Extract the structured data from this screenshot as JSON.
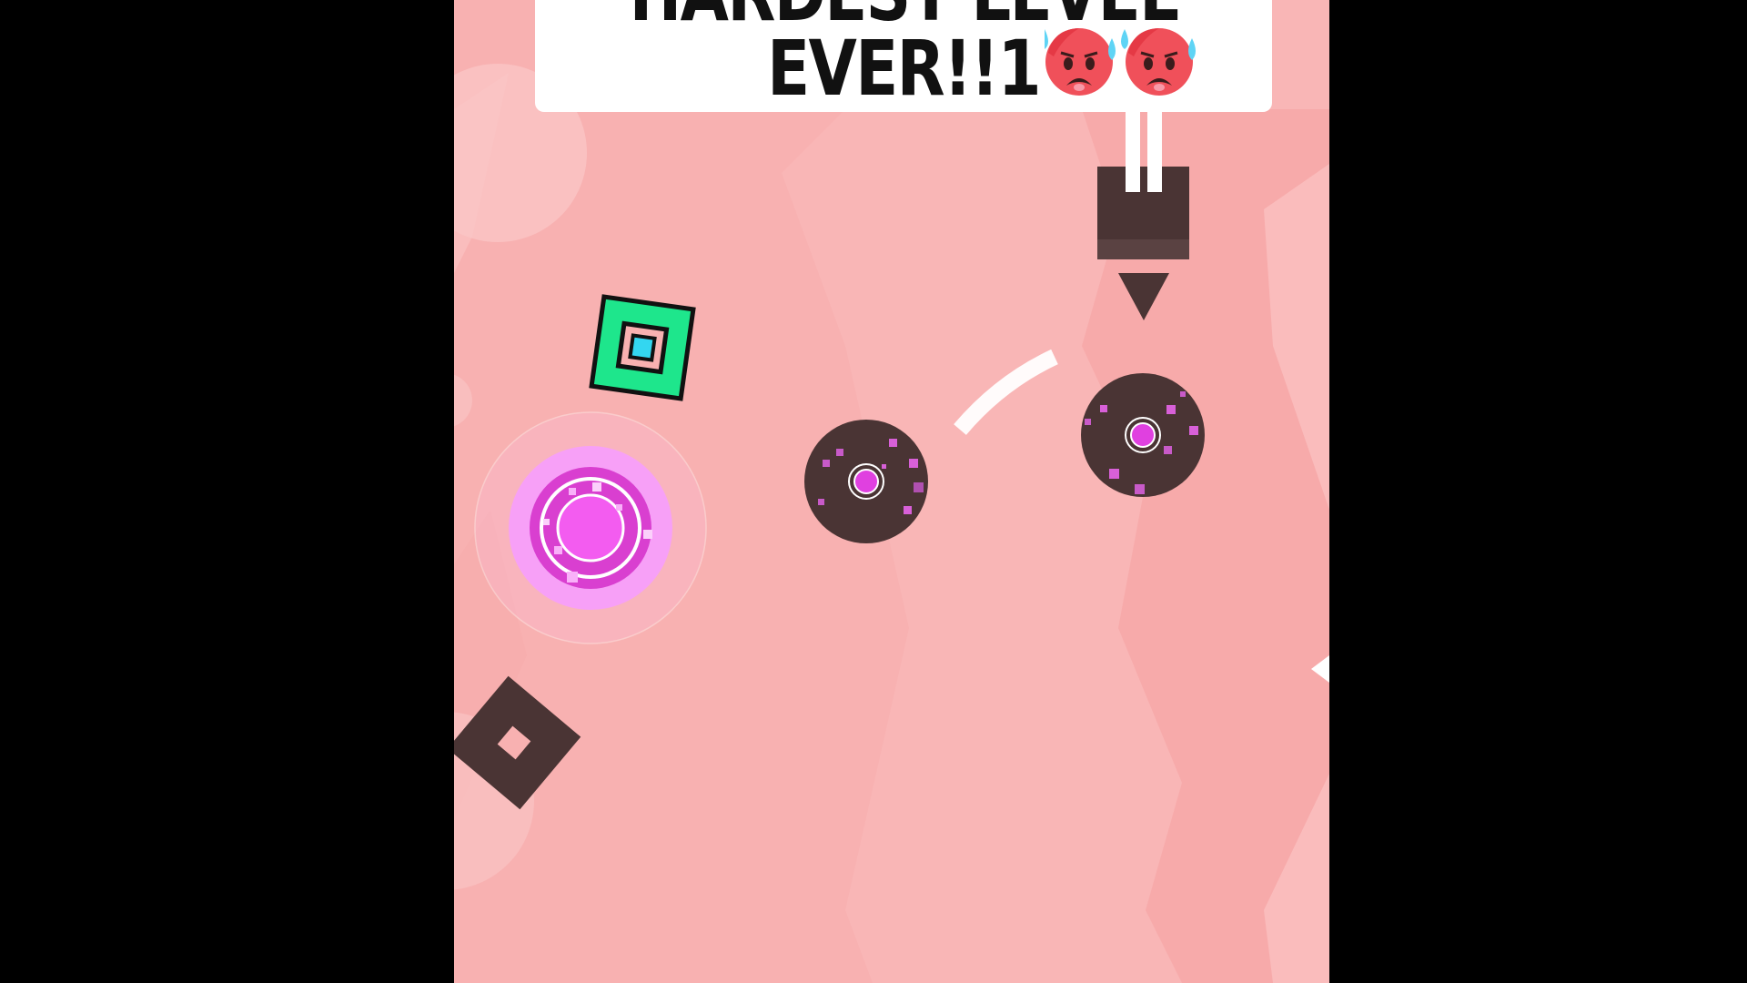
{
  "banner": {
    "title_line1": "HARDEST LEVEL",
    "title_line2": "EVER!!1",
    "emoji": [
      "fearful-sweat-face-emoji",
      "fearful-sweat-face-emoji"
    ]
  },
  "colors": {
    "background": "#f8b1b1",
    "background_light": "#fbc2c2",
    "letterbox": "#000000",
    "player_fill": "#1ee68c",
    "player_core": "#33d6f0",
    "obstacle": "#4a3434",
    "orb_magenta": "#e040e0",
    "orb_glow": "#f7a0f7",
    "banner": "#ffffff"
  },
  "sprites": {
    "player": "green-square-player",
    "jump_orb": "pink-jump-orb",
    "saws": [
      "dark-saw-orb",
      "dark-saw-orb"
    ],
    "crusher": "dark-crusher-block",
    "spike": "downward-spike",
    "block": "rotating-dark-block"
  }
}
